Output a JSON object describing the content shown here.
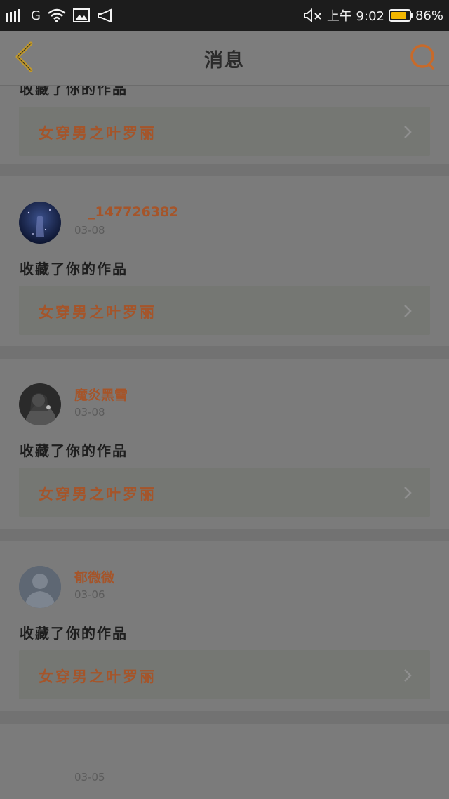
{
  "status_bar": {
    "network": "G",
    "time": "上午 9:02",
    "battery": "86%",
    "battery_level": 0.86
  },
  "header": {
    "title": "消息"
  },
  "messages": [
    {
      "partial_action": "收藏了你的作品",
      "work_title": "女穿男之叶罗丽"
    },
    {
      "username": "_147726382",
      "date": "03-08",
      "action": "收藏了你的作品",
      "work_title": "女穿男之叶罗丽"
    },
    {
      "username": "魔炎黑雪",
      "date": "03-08",
      "action": "收藏了你的作品",
      "work_title": "女穿男之叶罗丽"
    },
    {
      "username": "郁微微",
      "date": "03-06",
      "action": "收藏了你的作品",
      "work_title": "女穿男之叶罗丽"
    },
    {
      "username": "",
      "date": "03-05"
    }
  ],
  "colors": {
    "accent": "#a5552a",
    "overlay": "#7b7b7b",
    "back_icon": "#c39a2a",
    "search_icon": "#c86a2a"
  },
  "icons": [
    "back-icon",
    "search-icon",
    "chevron-right-icon",
    "default-avatar-icon"
  ]
}
